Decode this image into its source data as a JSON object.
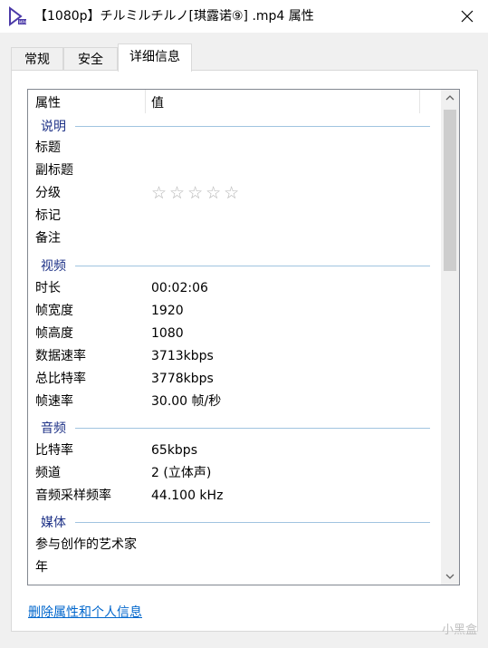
{
  "window": {
    "title": "【1080p】チルミルチルノ[琪露诺⑨] .mp4 属性"
  },
  "tabs": [
    {
      "label": "常规"
    },
    {
      "label": "安全"
    },
    {
      "label": "详细信息"
    }
  ],
  "columns": {
    "property": "属性",
    "value": "值"
  },
  "groups": {
    "description": {
      "label": "说明",
      "rows": [
        {
          "key": "标题",
          "value": ""
        },
        {
          "key": "副标题",
          "value": ""
        },
        {
          "key": "分级",
          "rating": 0,
          "stars": "☆☆☆☆☆"
        },
        {
          "key": "标记",
          "value": ""
        },
        {
          "key": "备注",
          "value": ""
        }
      ]
    },
    "video": {
      "label": "视频",
      "rows": [
        {
          "key": "时长",
          "value": "00:02:06"
        },
        {
          "key": "帧宽度",
          "value": "1920"
        },
        {
          "key": "帧高度",
          "value": "1080"
        },
        {
          "key": "数据速率",
          "value": "3713kbps"
        },
        {
          "key": "总比特率",
          "value": "3778kbps"
        },
        {
          "key": "帧速率",
          "value": "30.00 帧/秒"
        }
      ]
    },
    "audio": {
      "label": "音频",
      "rows": [
        {
          "key": "比特率",
          "value": "65kbps"
        },
        {
          "key": "频道",
          "value": "2 (立体声)"
        },
        {
          "key": "音频采样频率",
          "value": "44.100 kHz"
        }
      ]
    },
    "media": {
      "label": "媒体",
      "rows": [
        {
          "key": "参与创作的艺术家",
          "value": ""
        },
        {
          "key": "年",
          "value": ""
        }
      ]
    }
  },
  "footer": {
    "remove_link": "删除属性和个人信息"
  },
  "watermark": "小黑盒",
  "icons": {
    "app": "media-player-icon",
    "close": "close-icon",
    "scroll_up": "chevron-up-icon",
    "scroll_down": "chevron-down-icon"
  },
  "colors": {
    "group_label": "#1e3287",
    "group_line": "#a0c4e0",
    "link": "#0066cc",
    "star": "#b4b4b4"
  }
}
